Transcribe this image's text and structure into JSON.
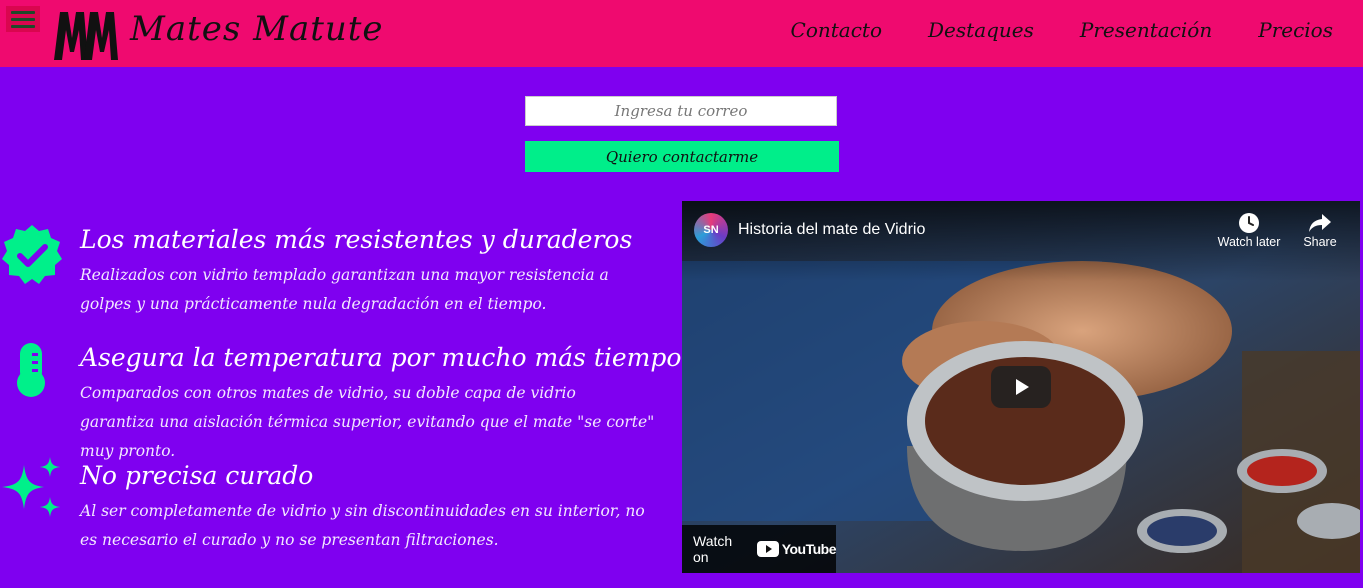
{
  "header": {
    "brand": "Mates Matute",
    "logo_icon": "mm-monogram-icon",
    "menu_icon": "hamburger-icon",
    "nav": [
      {
        "label": "Contacto"
      },
      {
        "label": "Destaques"
      },
      {
        "label": "Presentación"
      },
      {
        "label": "Precios"
      }
    ]
  },
  "form": {
    "email_placeholder": "Ingresa tu correo",
    "email_value": "",
    "submit_label": "Quiero contactarme"
  },
  "features": [
    {
      "icon": "verified-badge-icon",
      "title": "Los materiales más resistentes y duraderos",
      "text": "Realizados con vidrio templado garantizan una mayor resistencia a golpes y una prácticamente nula degradación en el tiempo."
    },
    {
      "icon": "thermometer-icon",
      "title": "Asegura la temperatura por mucho más tiempo",
      "text": "Comparados con otros mates de vidrio, su doble capa de vidrio garantiza una aislación térmica superior, evitando que el mate \"se corte\" muy pronto."
    },
    {
      "icon": "sparkles-icon",
      "title": "No precisa curado",
      "text": "Al ser completamente de vidrio y sin discontinuidades en su interior, no es necesario el curado y no se presentan filtraciones."
    }
  ],
  "video": {
    "channel_avatar_text": "SN",
    "title": "Historia del mate de Vidrio",
    "watch_later_label": "Watch later",
    "share_label": "Share",
    "watch_on_label": "Watch on",
    "youtube_label": "YouTube"
  },
  "colors": {
    "header_bg": "#ef0a6f",
    "page_bg": "#7f00f0",
    "button_bg": "#00ee8a",
    "icon_color": "#00f08a"
  }
}
